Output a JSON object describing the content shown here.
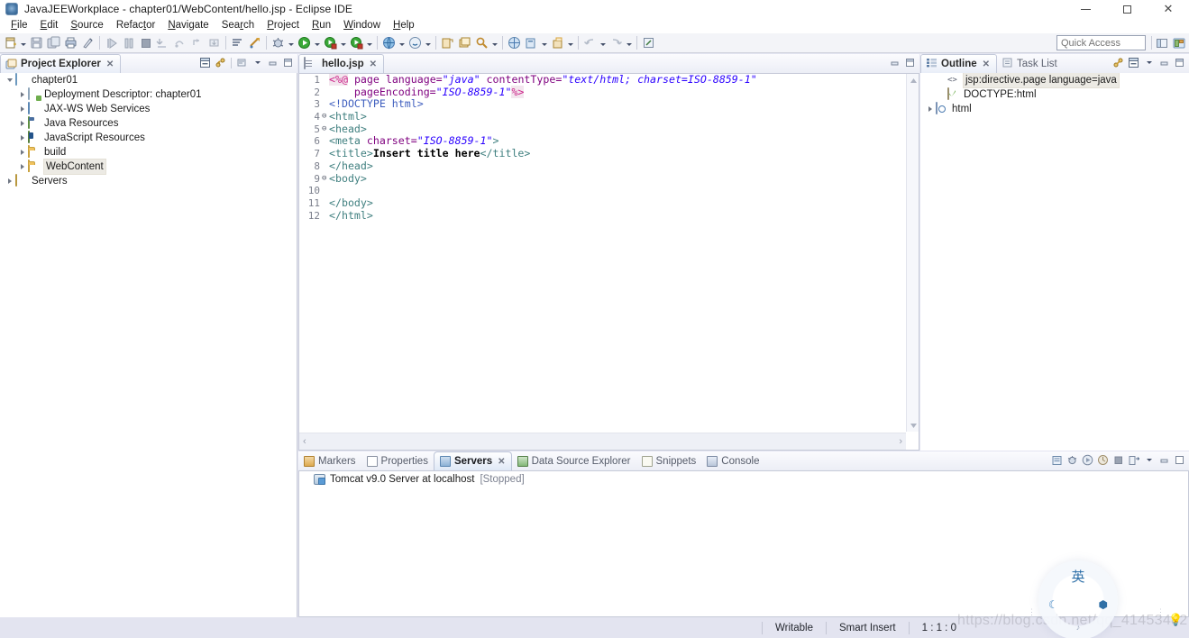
{
  "window": {
    "title": "JavaJEEWorkplace - chapter01/WebContent/hello.jsp - Eclipse IDE",
    "icon": "eclipse-icon",
    "minimize": "minimize",
    "maximize": "maximize",
    "close": "close"
  },
  "menubar": {
    "items": [
      {
        "label": "File",
        "mnemonic": "F"
      },
      {
        "label": "Edit",
        "mnemonic": "E"
      },
      {
        "label": "Source",
        "mnemonic": "S"
      },
      {
        "label": "Refactor",
        "mnemonic": "t"
      },
      {
        "label": "Navigate",
        "mnemonic": "N"
      },
      {
        "label": "Search",
        "mnemonic": "r"
      },
      {
        "label": "Project",
        "mnemonic": "P"
      },
      {
        "label": "Run",
        "mnemonic": "R"
      },
      {
        "label": "Window",
        "mnemonic": "W"
      },
      {
        "label": "Help",
        "mnemonic": "H"
      }
    ]
  },
  "toolbar": {
    "quick_access_placeholder": "Quick Access",
    "buttons": [
      "new-wizard-icon",
      "save-icon",
      "save-all-icon",
      "print-icon",
      "quick-fix-icon",
      "resume-icon",
      "suspend-icon",
      "terminate-icon",
      "step-into-icon",
      "step-over-icon",
      "step-return-icon",
      "drop-to-frame-icon",
      "skip-breakpoints-icon",
      "next-annotation-icon",
      "debug-icon",
      "run-icon",
      "run-as-icon",
      "coverage-icon",
      "external-tools-icon",
      "new-jsp-icon",
      "new-servlet-icon",
      "open-type-icon",
      "search-icon",
      "new-java-project-icon",
      "new-class-icon",
      "new-package-icon",
      "back-icon",
      "forward-icon",
      "last-edit-icon"
    ],
    "perspective_buttons": [
      "open-perspective-icon",
      "java-ee-perspective-icon"
    ]
  },
  "project_explorer": {
    "tab": "Project Explorer",
    "tools": [
      "collapse-all-icon",
      "link-with-editor-icon",
      "view-menu-icon",
      "minimize-icon",
      "maximize-icon"
    ],
    "tree": [
      {
        "label": "chapter01",
        "depth": 0,
        "expanded": true,
        "icon": "project-icon",
        "selected": false
      },
      {
        "label": "Deployment Descriptor: chapter01",
        "depth": 1,
        "expanded": false,
        "icon": "deployment-descriptor-icon",
        "selected": false
      },
      {
        "label": "JAX-WS Web Services",
        "depth": 1,
        "expanded": false,
        "icon": "jaxws-icon",
        "selected": false
      },
      {
        "label": "Java Resources",
        "depth": 1,
        "expanded": false,
        "icon": "java-resources-icon",
        "selected": false
      },
      {
        "label": "JavaScript Resources",
        "depth": 1,
        "expanded": false,
        "icon": "javascript-resources-icon",
        "selected": false
      },
      {
        "label": "build",
        "depth": 1,
        "expanded": false,
        "icon": "folder-icon",
        "selected": false
      },
      {
        "label": "WebContent",
        "depth": 1,
        "expanded": false,
        "icon": "folder-icon",
        "selected": true
      },
      {
        "label": "Servers",
        "depth": 0,
        "expanded": false,
        "icon": "servers-folder-icon",
        "selected": false
      }
    ]
  },
  "editor": {
    "tab": "hello.jsp",
    "tab_icon": "jsp-file-icon",
    "close": "✕",
    "tools": [
      "minimize-icon",
      "maximize-icon"
    ],
    "lines": [
      {
        "num": "1",
        "fold": "",
        "segments": [
          {
            "t": "<%@",
            "c": "k-jsp"
          },
          {
            "t": " ",
            "c": "k-plain"
          },
          {
            "t": "page",
            "c": "k-attr"
          },
          {
            "t": " ",
            "c": "k-plain"
          },
          {
            "t": "language=",
            "c": "k-attr"
          },
          {
            "t": "\"java\"",
            "c": "k-val"
          },
          {
            "t": " ",
            "c": "k-plain"
          },
          {
            "t": "contentType=",
            "c": "k-attr"
          },
          {
            "t": "\"text/html; charset=ISO-8859-1\"",
            "c": "k-val"
          }
        ]
      },
      {
        "num": "2",
        "fold": "",
        "segments": [
          {
            "t": "    ",
            "c": "k-plain"
          },
          {
            "t": "pageEncoding=",
            "c": "k-attr"
          },
          {
            "t": "\"ISO-8859-1\"",
            "c": "k-val"
          },
          {
            "t": "%>",
            "c": "k-jsp"
          }
        ]
      },
      {
        "num": "3",
        "fold": "",
        "segments": [
          {
            "t": "<!DOCTYPE html>",
            "c": "k-doctype"
          }
        ]
      },
      {
        "num": "4",
        "fold": "⊖",
        "segments": [
          {
            "t": "<html>",
            "c": "k-tag"
          }
        ]
      },
      {
        "num": "5",
        "fold": "⊖",
        "segments": [
          {
            "t": "<head>",
            "c": "k-tag"
          }
        ]
      },
      {
        "num": "6",
        "fold": "",
        "segments": [
          {
            "t": "<meta ",
            "c": "k-tag"
          },
          {
            "t": "charset=",
            "c": "k-attr"
          },
          {
            "t": "\"ISO-8859-1\"",
            "c": "k-val"
          },
          {
            "t": ">",
            "c": "k-tag"
          }
        ]
      },
      {
        "num": "7",
        "fold": "",
        "segments": [
          {
            "t": "<title>",
            "c": "k-tag"
          },
          {
            "t": "Insert title here",
            "c": "k-title"
          },
          {
            "t": "</title>",
            "c": "k-tag"
          }
        ]
      },
      {
        "num": "8",
        "fold": "",
        "segments": [
          {
            "t": "</head>",
            "c": "k-tag"
          }
        ]
      },
      {
        "num": "9",
        "fold": "⊖",
        "segments": [
          {
            "t": "<body>",
            "c": "k-tag"
          }
        ]
      },
      {
        "num": "10",
        "fold": "",
        "segments": [
          {
            "t": "",
            "c": "k-plain"
          }
        ]
      },
      {
        "num": "11",
        "fold": "",
        "segments": [
          {
            "t": "</body>",
            "c": "k-tag"
          }
        ]
      },
      {
        "num": "12",
        "fold": "",
        "segments": [
          {
            "t": "</html>",
            "c": "k-tag"
          }
        ]
      }
    ]
  },
  "outline": {
    "tabs": [
      {
        "label": "Outline",
        "active": true,
        "icon": "outline-icon",
        "close": "✕"
      },
      {
        "label": "Task List",
        "active": false,
        "icon": "task-list-icon"
      }
    ],
    "tools": [
      "link-with-editor-icon",
      "collapse-all-icon",
      "view-menu-icon",
      "minimize-icon",
      "maximize-icon"
    ],
    "tree": [
      {
        "label": "jsp:directive.page language=java",
        "depth": 1,
        "expanded": false,
        "arrow": false,
        "icon": "jsp-directive-icon",
        "selected": true
      },
      {
        "label": "DOCTYPE:html",
        "depth": 1,
        "expanded": false,
        "arrow": false,
        "icon": "doctype-icon",
        "selected": false
      },
      {
        "label": "html",
        "depth": 0,
        "expanded": false,
        "arrow": true,
        "icon": "html-element-icon",
        "selected": false
      }
    ]
  },
  "bottom": {
    "tabs": [
      {
        "label": "Markers",
        "active": false,
        "icon": "markers-icon"
      },
      {
        "label": "Properties",
        "active": false,
        "icon": "properties-icon"
      },
      {
        "label": "Servers",
        "active": true,
        "icon": "servers-icon",
        "close": "✕"
      },
      {
        "label": "Data Source Explorer",
        "active": false,
        "icon": "data-source-explorer-icon"
      },
      {
        "label": "Snippets",
        "active": false,
        "icon": "snippets-icon"
      },
      {
        "label": "Console",
        "active": false,
        "icon": "console-icon"
      }
    ],
    "tools": [
      "new-server-icon",
      "debug-server-icon",
      "start-server-icon",
      "profile-server-icon",
      "stop-server-icon",
      "publish-icon",
      "view-menu-icon",
      "minimize-icon",
      "maximize-icon"
    ],
    "servers": [
      {
        "name": "Tomcat v9.0 Server at localhost",
        "state": "[Stopped]",
        "icon": "tomcat-server-icon"
      }
    ]
  },
  "statusbar": {
    "writable": "Writable",
    "insert_mode": "Smart Insert",
    "position": "1 : 1 : 0"
  },
  "overlay": {
    "ime_mode": "英",
    "ime_moon": "☾",
    "ime_gear": "⬢",
    "ime_dot": "♪",
    "ime_bulb": "💡",
    "watermark": "https://blog.csdn.net/qq_41453482"
  }
}
